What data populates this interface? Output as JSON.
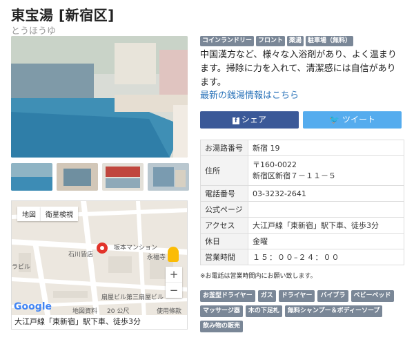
{
  "header": {
    "title": "東宝湯 [新宿区]",
    "subtitle": "とうほうゆ"
  },
  "facility_tags": [
    "コインランドリー",
    "フロント",
    "薬湯",
    "駐車場（無料）"
  ],
  "description": "中国漢方など、様々な入浴剤があり、よく温まります。掃除に力を入れて、清潔感には自信があります。",
  "latest_link": "最新の銭湯情報はこちら",
  "share": {
    "facebook": "シェア",
    "twitter": "ツイート"
  },
  "info": [
    {
      "key": "お湯路番号",
      "value": "新宿 19"
    },
    {
      "key": "住所",
      "value": "〒160-0022\n新宿区新宿７－１１－５"
    },
    {
      "key": "電話番号",
      "value": "03-3232-2641"
    },
    {
      "key": "公式ページ",
      "value": ""
    },
    {
      "key": "アクセス",
      "value": "大江戸線「東新宿」駅下車、徒歩3分"
    },
    {
      "key": "休日",
      "value": "金曜"
    },
    {
      "key": "営業時間",
      "value": "１５：００–２４：００"
    }
  ],
  "phone_note": "※お電話は営業時間内にお願い致します。",
  "amenity_tags": [
    "お釜型ドライヤー",
    "ガス",
    "ドライヤー",
    "バイブラ",
    "ベビーベッド",
    "マッサージ器",
    "木の下足札",
    "無料シャンプー＆ボディーソープ",
    "飲み物の販売"
  ],
  "map": {
    "btn_map": "地図",
    "btn_sat": "衛星検視",
    "labels": [
      "石川皆店",
      "坂本マンション",
      "永福寺",
      "扇屋ビル第三扇屋ビル",
      "ラビル",
      "地図資料",
      "20 公尺",
      "使用條款"
    ],
    "google": "Google",
    "footer": "大江戸線「東新宿」駅下車、徒歩3分"
  }
}
